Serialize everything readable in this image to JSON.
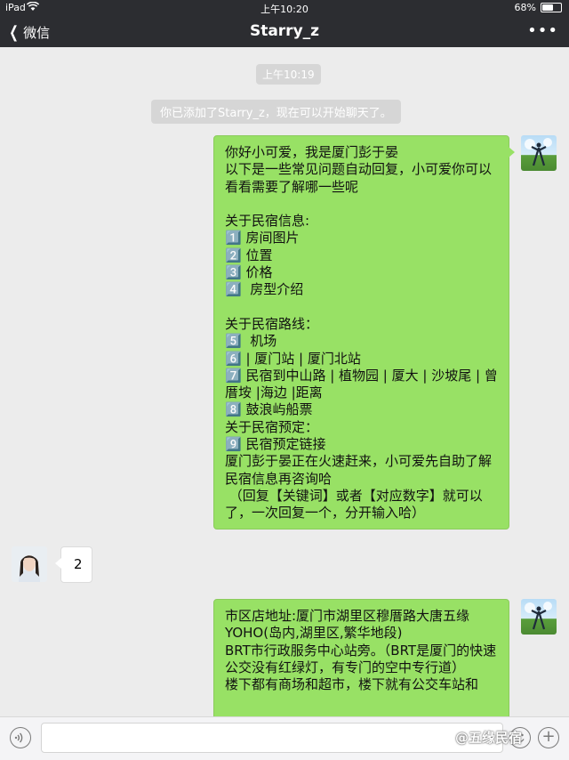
{
  "status_bar": {
    "device": "iPad",
    "time": "上午10:20",
    "battery": "68%",
    "battery_level": 0.68
  },
  "nav": {
    "back_label": "微信",
    "title": "Starry_z",
    "more": "•••"
  },
  "chat": {
    "timestamp": "上午10:19",
    "system_notice": "你已添加了Starry_z，现在可以开始聊天了。",
    "messages": [
      {
        "from": "me",
        "text": "你好小可爱，我是厦门彭于晏\n以下是一些常见问题自动回复，小可爱你可以看看需要了解哪一些呢\n\n关于民宿信息:\n1️⃣ 房间图片\n2️⃣ 位置\n3️⃣ 价格\n4️⃣  房型介绍\n\n关于民宿路线：\n5️⃣  机场\n6️⃣ | 厦门站 | 厦门北站\n7️⃣ 民宿到中山路 | 植物园 | 厦大 | 沙坡尾 | 曾厝垵 |海边 |距离\n8️⃣ 鼓浪屿船票\n关于民宿预定：\n9️⃣ 民宿预定链接\n厦门彭于晏正在火速赶来，小可爱先自助了解民宿信息再咨询哈\n （回复【关键词】或者【对应数字】就可以了，一次回复一个，分开输入哈）"
      },
      {
        "from": "other",
        "text": "2"
      },
      {
        "from": "me",
        "text": "市区店地址:厦门市湖里区穆厝路大唐五缘YOHO(岛内,湖里区,繁华地段)\nBRT市行政服务中心站旁。（BRT是厦门的快速公交没有红绿灯，有专门的空中专行道）\n楼下都有商场和超市，楼下就有公交车站和"
      }
    ]
  },
  "watermark": "@五缘民宿"
}
